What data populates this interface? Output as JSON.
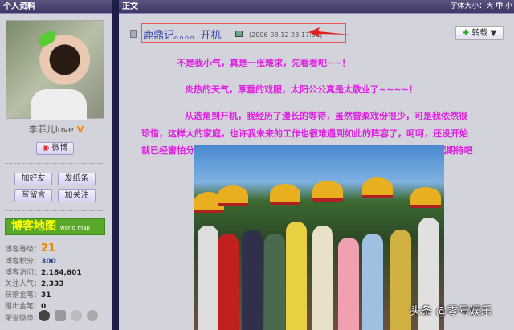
{
  "sidebar": {
    "header": "个人资料",
    "username": "李菲儿love",
    "verified": "V",
    "weibo_button": "微博",
    "actions": [
      "加好友",
      "发纸条",
      "写留言",
      "加关注"
    ],
    "map_banner": {
      "title": "博客地图",
      "subtitle": "world map"
    },
    "stats": [
      {
        "label": "博客等级：",
        "value": "21"
      },
      {
        "label": "博客积分：",
        "value": "300"
      },
      {
        "label": "博客访问：",
        "value": "2,184,601"
      },
      {
        "label": "关注人气：",
        "value": "2,333"
      },
      {
        "label": "获赠金笔：",
        "value": "31"
      },
      {
        "label": "赠出金笔：",
        "value": "0"
      }
    ],
    "medals_label": "荣誉徽章："
  },
  "main": {
    "header": "正文",
    "font_size_label": "字体大小：",
    "font_sizes": [
      "大",
      "中",
      "小"
    ],
    "post_title": "鹿鼎记。。。。开机",
    "post_date": "(2006-08-12 23:17:56)",
    "repost_button": "转载",
    "paragraphs": [
      "不是我小气，真是一张难求，先看看吧~~！",
      "炎热的天气，厚重的戏服，太阳公公真是太敬业了~~~~！",
      "从选角到开机，我经历了漫长的等待，虽然曾柔戏份很少，可是我依然很",
      "珍惜，这样大的家庭，也许我未来的工作也很难遇到如此的阵容了，呵呵，还没开始",
      "就已经害怕分离了，这样小女人的感慨，不正是曾柔的性格吗~~~！我们一起期待吧"
    ]
  },
  "watermark": "头条 @零号娱乐"
}
